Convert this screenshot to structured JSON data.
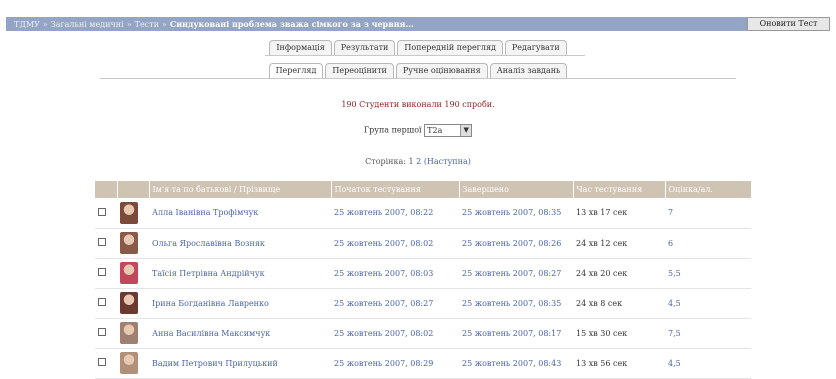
{
  "breadcrumb": {
    "items": [
      "ТДМУ",
      "Загальні медичні",
      "Тести"
    ],
    "separator": "»",
    "current": "Синдуковані проблема зважа сімкого за з червня..."
  },
  "edit_button": "Оновити Тест",
  "tabs_row1": [
    "Інформація",
    "Результати",
    "Попередній перегляд",
    "Редагувати"
  ],
  "tabs_row2": [
    "Перегляд",
    "Переоцінити",
    "Ручне оцінювання",
    "Аналіз завдань"
  ],
  "tabs_row2_active": 0,
  "message": "190 Студенти виконали 190 спроби.",
  "group": {
    "label": "Група першої",
    "value": "T2а"
  },
  "pagination": {
    "label": "Сторінка:",
    "current": "1",
    "next_page": "2",
    "next_label": "(Наступна)"
  },
  "table": {
    "headers": [
      "",
      "",
      "Ім'я та по батькові / Прізвище",
      "Початок тестування",
      "Завершено",
      "Час тестування",
      "Оцінка/ал."
    ],
    "rows": [
      {
        "name": "Алла Іванівна Трофімчук",
        "start": "25 жовтень 2007, 08:22",
        "end": "25 жовтень 2007, 08:35",
        "duration": "13 хв 17 сек",
        "score": "7",
        "photo_color": "#7a4a3a"
      },
      {
        "name": "Ольга Ярославівна Возняк",
        "start": "25 жовтень 2007, 08:02",
        "end": "25 жовтень 2007, 08:26",
        "duration": "24 хв 12 сек",
        "score": "6",
        "photo_color": "#8a5a48"
      },
      {
        "name": "Таїсія Петрівна Андрійчук",
        "start": "25 жовтень 2007, 08:03",
        "end": "25 жовтень 2007, 08:27",
        "duration": "24 хв 20 сек",
        "score": "5,5",
        "photo_color": "#c0485a"
      },
      {
        "name": "Ірина Богданівна Лавренко",
        "start": "25 жовтень 2007, 08:27",
        "end": "25 жовтень 2007, 08:35",
        "duration": "24 хв 8 сек",
        "score": "4,5",
        "photo_color": "#6a3a30"
      },
      {
        "name": "Анна Василівна Максимчук",
        "start": "25 жовтень 2007, 08:02",
        "end": "25 жовтень 2007, 08:17",
        "duration": "15 хв 30 сек",
        "score": "7,5",
        "photo_color": "#a08070"
      },
      {
        "name": "Вадим Петрович Прилуцький",
        "start": "25 жовтень 2007, 08:29",
        "end": "25 жовтень 2007, 08:43",
        "duration": "13 хв 56 сек",
        "score": "4,5",
        "photo_color": "#b09078"
      }
    ]
  }
}
